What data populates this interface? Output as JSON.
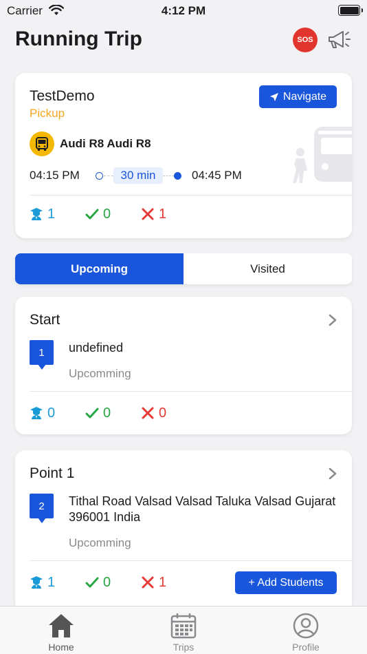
{
  "status_bar": {
    "carrier": "Carrier",
    "time": "4:12 PM"
  },
  "header": {
    "title": "Running Trip",
    "sos_label": "SOS"
  },
  "trip": {
    "name": "TestDemo",
    "type": "Pickup",
    "navigate_label": "Navigate",
    "vehicle": "Audi R8 Audi R8",
    "start_time": "04:15 PM",
    "duration": "30 min",
    "end_time": "04:45 PM",
    "stats": {
      "total": "1",
      "present": "0",
      "absent": "1"
    }
  },
  "tabs": [
    {
      "label": "Upcoming",
      "active": true
    },
    {
      "label": "Visited",
      "active": false
    }
  ],
  "stops": [
    {
      "title": "Start",
      "number": "1",
      "address": "undefined",
      "status": "Upcomming",
      "total": "0",
      "present": "0",
      "absent": "0"
    },
    {
      "title": "Point 1",
      "number": "2",
      "address": "Tithal Road Valsad Valsad Taluka Valsad Gujarat 396001 India",
      "status": "Upcomming",
      "total": "1",
      "present": "0",
      "absent": "1",
      "add_label": "+ Add Students"
    }
  ],
  "tabbar": [
    {
      "label": "Home",
      "icon": "home-icon",
      "active": true
    },
    {
      "label": "Trips",
      "icon": "calendar-icon",
      "active": false
    },
    {
      "label": "Profile",
      "icon": "profile-icon",
      "active": false
    }
  ],
  "colors": {
    "primary": "#1a56db",
    "pickup": "#f5a623",
    "present": "#27a744",
    "absent": "#e53935",
    "total": "#1a9bd7",
    "sos": "#e2352d"
  }
}
